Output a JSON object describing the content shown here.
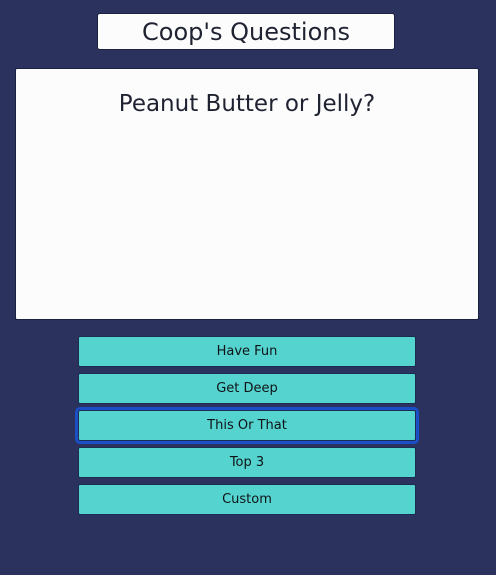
{
  "app": {
    "title": "Coop's Questions"
  },
  "question": {
    "text": "Peanut Butter or Jelly?"
  },
  "categories": [
    {
      "label": "Have Fun"
    },
    {
      "label": "Get Deep"
    },
    {
      "label": "This Or That"
    },
    {
      "label": "Top 3"
    },
    {
      "label": "Custom"
    }
  ],
  "selected_category": "This Or That",
  "colors": {
    "background": "#2b325e",
    "button": "#55d3cf",
    "focus_ring": "#1a4fc6",
    "card": "#fcfcfd"
  }
}
